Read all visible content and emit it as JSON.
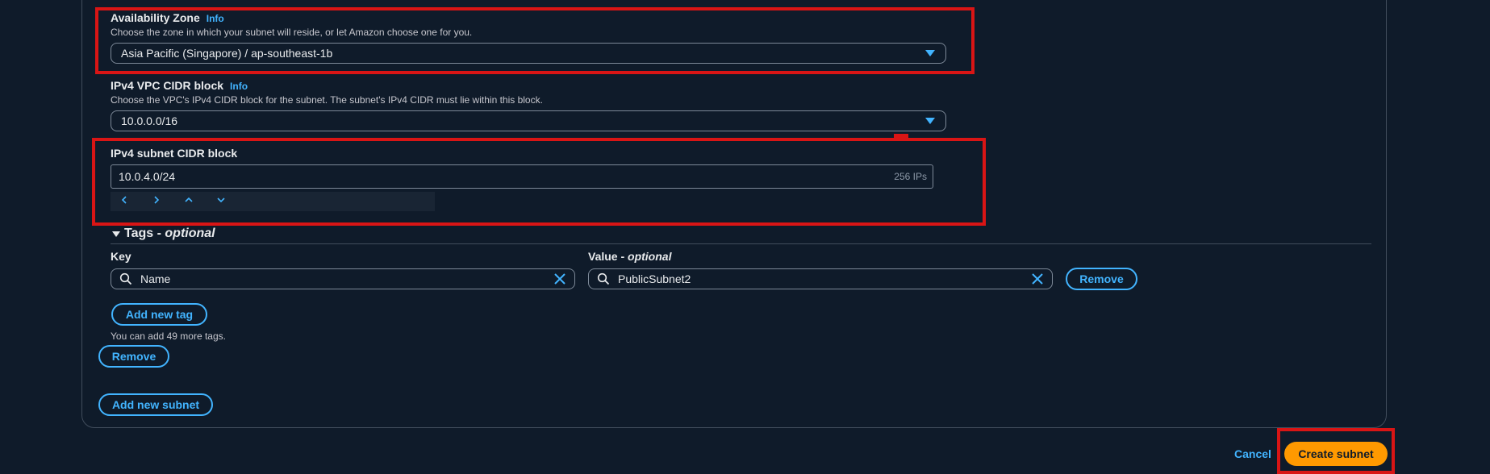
{
  "availability_zone": {
    "label": "Availability Zone",
    "info": "Info",
    "description": "Choose the zone in which your subnet will reside, or let Amazon choose one for you.",
    "value": "Asia Pacific (Singapore) / ap-southeast-1b"
  },
  "vpc_cidr": {
    "label": "IPv4 VPC CIDR block",
    "info": "Info",
    "description": "Choose the VPC's IPv4 CIDR block for the subnet. The subnet's IPv4 CIDR must lie within this block.",
    "value": "10.0.0.0/16"
  },
  "subnet_cidr": {
    "label": "IPv4 subnet CIDR block",
    "value": "10.0.4.0/24",
    "ip_count": "256 IPs"
  },
  "tags": {
    "section_title": "Tags -",
    "section_optional": "optional",
    "key_label": "Key",
    "value_label": "Value -",
    "value_optional": "optional",
    "key_value": "Name",
    "value_value": "PublicSubnet2",
    "remove_tag": "Remove",
    "add_new_tag": "Add new tag",
    "remaining": "You can add 49 more tags."
  },
  "subnet_actions": {
    "remove_subnet": "Remove",
    "add_new_subnet": "Add new subnet"
  },
  "footer": {
    "cancel": "Cancel",
    "create": "Create subnet"
  },
  "colors": {
    "background": "#0f1b2a",
    "accent": "#42b4ff",
    "primary_button": "#ff9900",
    "highlight_box": "#d91515"
  },
  "icons": [
    "caret-down-icon",
    "chevron-left-icon",
    "chevron-right-icon",
    "chevron-up-icon",
    "chevron-down-icon",
    "search-icon",
    "close-icon",
    "triangle-down-icon"
  ]
}
